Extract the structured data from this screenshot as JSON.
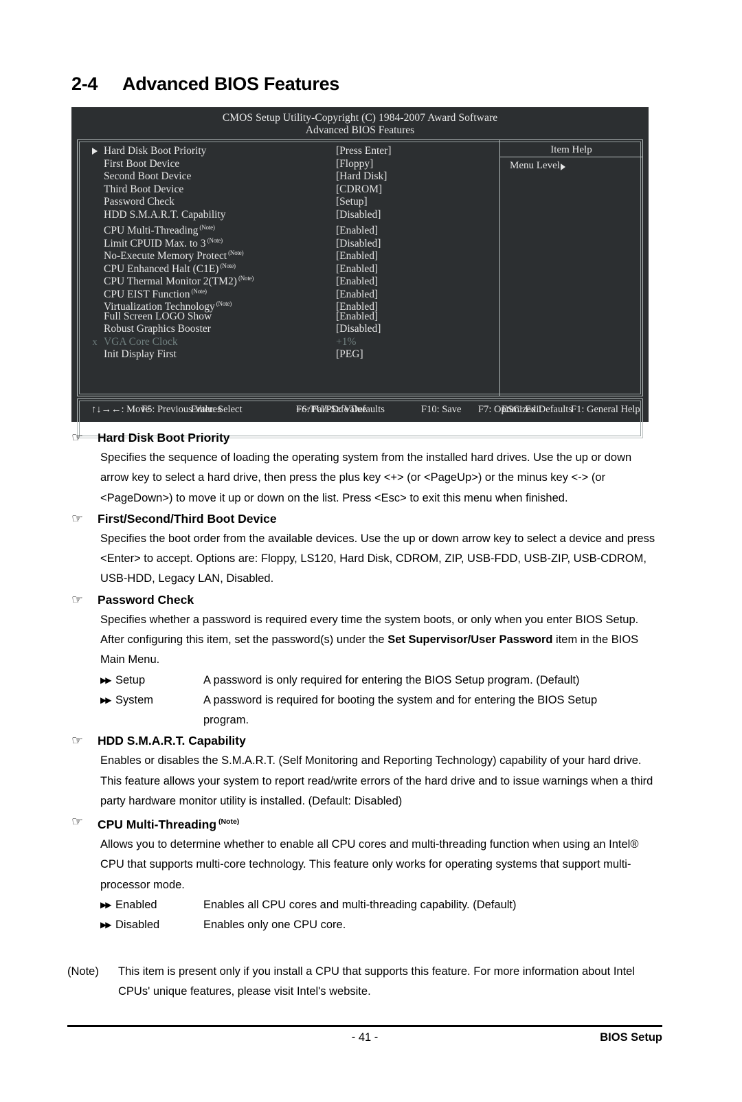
{
  "section": {
    "number": "2-4",
    "title": "Advanced BIOS Features"
  },
  "bios_screen": {
    "title": "CMOS Setup Utility-Copyright (C) 1984-2007 Award Software",
    "subtitle": "Advanced BIOS Features",
    "item_help_header": "Item Help",
    "menu_level_label": "Menu Level",
    "rows": [
      {
        "marker": "triangle",
        "label": "Hard Disk Boot Priority",
        "note": "",
        "value": "[Press Enter]",
        "dim": false
      },
      {
        "marker": "",
        "label": "First Boot Device",
        "note": "",
        "value": "[Floppy]",
        "dim": false
      },
      {
        "marker": "",
        "label": "Second Boot Device",
        "note": "",
        "value": "[Hard Disk]",
        "dim": false
      },
      {
        "marker": "",
        "label": "Third Boot Device",
        "note": "",
        "value": "[CDROM]",
        "dim": false
      },
      {
        "marker": "",
        "label": "Password Check",
        "note": "",
        "value": "[Setup]",
        "dim": false
      },
      {
        "marker": "",
        "label": "HDD S.M.A.R.T. Capability",
        "note": "",
        "value": "[Disabled]",
        "dim": false
      },
      {
        "marker": "",
        "label": "CPU Multi-Threading",
        "note": "(Note)",
        "value": "[Enabled]",
        "dim": false
      },
      {
        "marker": "",
        "label": "Limit CPUID Max. to 3",
        "note": "(Note)",
        "value": "[Disabled]",
        "dim": false
      },
      {
        "marker": "",
        "label": "No-Execute Memory Protect",
        "note": "(Note)",
        "value": "[Enabled]",
        "dim": false
      },
      {
        "marker": "",
        "label": "CPU Enhanced Halt (C1E)",
        "note": "(Note)",
        "value": "[Enabled]",
        "dim": false
      },
      {
        "marker": "",
        "label": "CPU Thermal Monitor 2(TM2)",
        "note": "(Note)",
        "value": "[Enabled]",
        "dim": false
      },
      {
        "marker": "",
        "label": "CPU EIST Function",
        "note": "(Note)",
        "value": "[Enabled]",
        "dim": false
      },
      {
        "marker": "",
        "label": "Virtualization Technology",
        "note": "(Note)",
        "value": "[Enabled]",
        "dim": false
      },
      {
        "marker": "",
        "label": "Full Screen LOGO Show",
        "note": "",
        "value": "[Enabled]",
        "dim": false
      },
      {
        "marker": "",
        "label": "Robust Graphics Booster",
        "note": "",
        "value": "[Disabled]",
        "dim": false
      },
      {
        "marker": "x",
        "label": "VGA Core Clock",
        "note": "",
        "value": "+1%",
        "dim": true
      },
      {
        "marker": "",
        "label": "Init Display First",
        "note": "",
        "value": "[PEG]",
        "dim": false
      }
    ],
    "keys": {
      "move": "↑↓→←: Move",
      "select": "Enter: Select",
      "value": "+/-/PU/PD: Value",
      "save": "F10: Save",
      "exit": "ESC: Exit",
      "general_help": "F1: General Help",
      "previous_values": "F5: Previous Values",
      "fail_safe": "F6: Fail-Safe Defaults",
      "optimized": "F7: Optimized Defaults"
    }
  },
  "topics": [
    {
      "heading": "Hard Disk Boot Priority",
      "note_sup": "",
      "paragraphs": [
        "Specifies the sequence of loading the operating system from the installed hard drives.  Use the up or down arrow key to select a hard drive, then press the plus key <+> (or <PageUp>) or the minus key <-> (or <PageDown>) to move it up or down on the list. Press <Esc> to exit this menu when finished."
      ],
      "options": []
    },
    {
      "heading": "First/Second/Third Boot Device",
      "note_sup": "",
      "paragraphs": [
        "Specifies the boot order from the available devices. Use the up or down arrow key to select a device and press <Enter> to accept. Options are: Floppy, LS120, Hard Disk, CDROM, ZIP, USB-FDD, USB-ZIP, USB-CDROM, USB-HDD, Legacy LAN, Disabled."
      ],
      "options": []
    },
    {
      "heading": "Password Check",
      "note_sup": "",
      "paragraphs": [
        "Specifies whether a password is required every time the system boots, or only when you enter BIOS Setup. After configuring this item, set the password(s) under the |Set Supervisor/User Password| item in the BIOS Main Menu."
      ],
      "options": [
        {
          "mark": "▶▶",
          "name": "Setup",
          "desc": "A password is only required for entering the BIOS Setup program. (Default)",
          "cont": ""
        },
        {
          "mark": "▶▶",
          "name": "System",
          "desc": "A password is required for booting the system and for entering the BIOS Setup",
          "cont": "program."
        }
      ]
    },
    {
      "heading": "HDD S.M.A.R.T. Capability",
      "note_sup": "",
      "paragraphs": [
        "Enables or disables the S.M.A.R.T. (Self Monitoring and Reporting Technology) capability of your hard drive. This feature allows your system to report read/write errors of the hard drive and to issue warnings when a third party hardware monitor utility is installed. (Default: Disabled)"
      ],
      "options": []
    },
    {
      "heading": "CPU Multi-Threading",
      "note_sup": "(Note)",
      "paragraphs": [
        "Allows you to determine whether to enable all CPU cores and multi-threading function when using an Intel® CPU that supports multi-core technology. This feature only works for operating systems that support multi-processor mode."
      ],
      "options": [
        {
          "mark": "▶▶",
          "name": "Enabled",
          "desc": "Enables all CPU cores and multi-threading capability. (Default)",
          "cont": ""
        },
        {
          "mark": "▶▶",
          "name": "Disabled",
          "desc": "Enables only one CPU core.",
          "cont": ""
        }
      ]
    }
  ],
  "footnote": {
    "tag": "(Note)",
    "text": "This item is present only if you install a CPU that supports this feature. For more information about Intel CPUs' unique features, please visit Intel's website."
  },
  "footer": {
    "page_number": "- 41 -",
    "right_label": "BIOS Setup"
  },
  "glyphs": {
    "hand": "☞"
  }
}
